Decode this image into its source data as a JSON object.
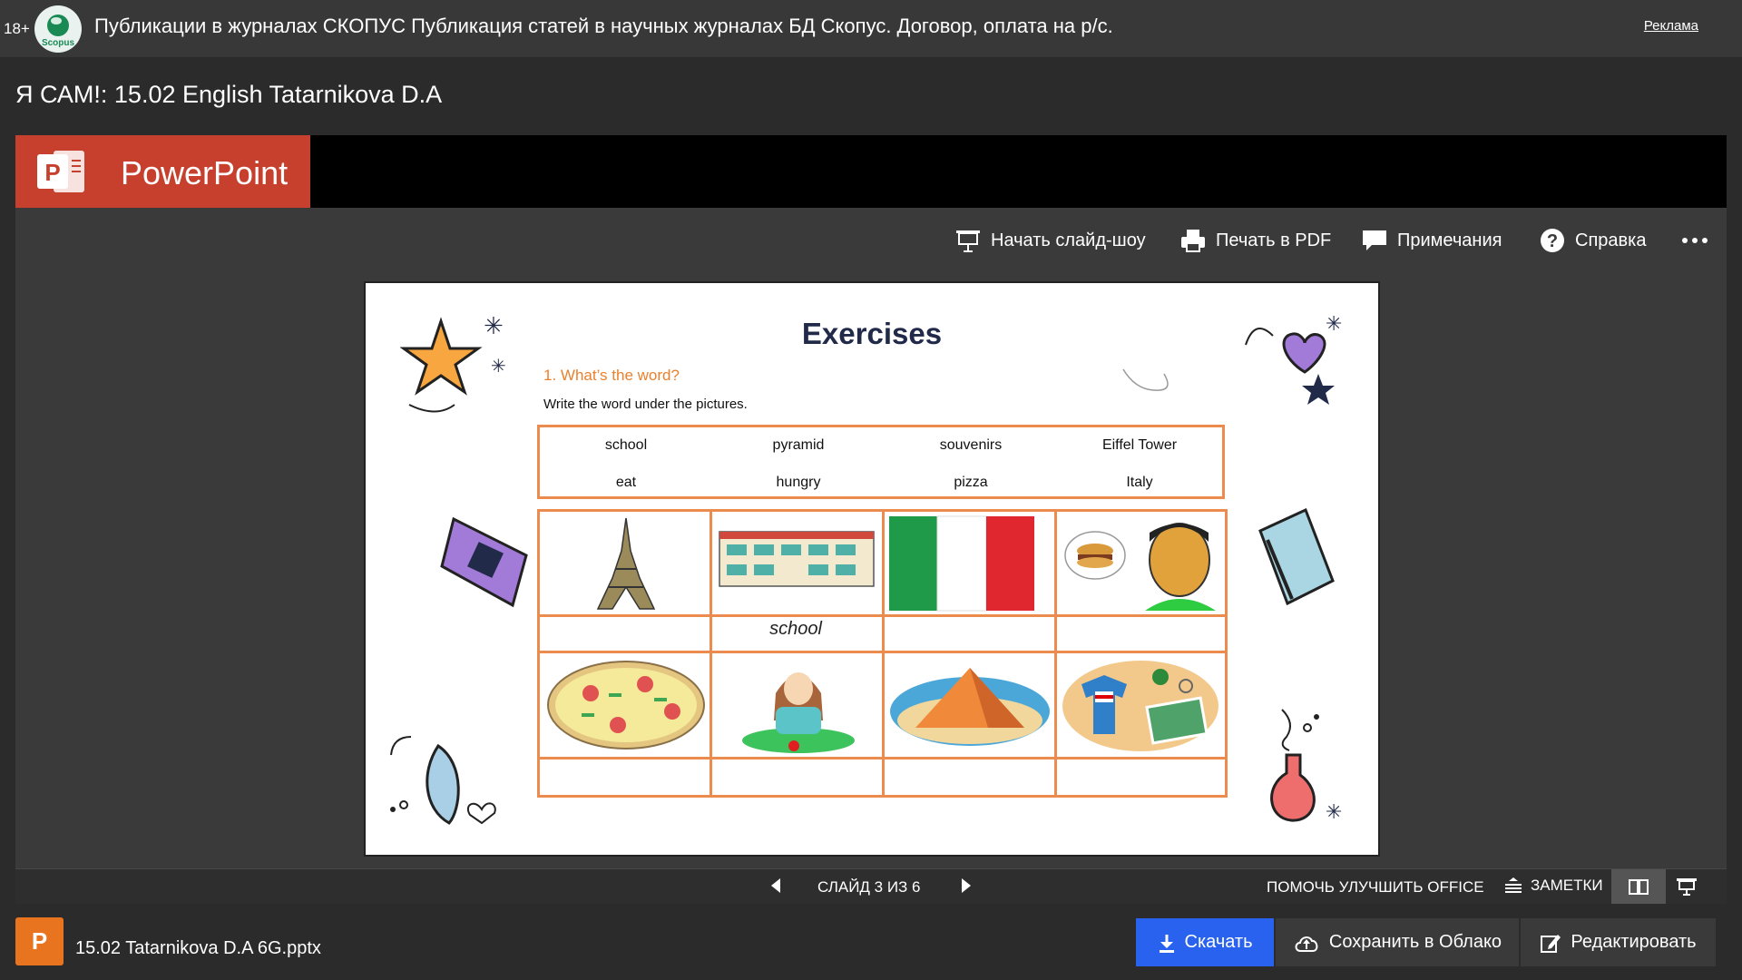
{
  "ad": {
    "age_badge": "18+",
    "logo_text": "Scopus",
    "text": "Публикации в журналах СКОПУС   Публикация статей в научных журналах БД Скопус. Договор, оплата на р/с.",
    "link": "Реклама"
  },
  "document": {
    "title": "Я САМ!: 15.02 English Tatarnikova D.A"
  },
  "viewer": {
    "app_name": "PowerPoint",
    "toolbar": {
      "slideshow": "Начать слайд-шоу",
      "print_pdf": "Печать в PDF",
      "notes": "Примечания",
      "help": "Справка"
    },
    "slide": {
      "title": "Exercises",
      "task": "1. What’s the word?",
      "instruction": "Write the word under the pictures.",
      "words_row1": [
        "school",
        "pyramid",
        "souvenirs",
        "Eiffel Tower"
      ],
      "words_row2": [
        "eat",
        "hungry",
        "pizza",
        "Italy"
      ],
      "answer_filled": "school"
    },
    "status_bar": {
      "slide_counter": "СЛАЙД 3 ИЗ 6",
      "improve": "ПОМОЧЬ УЛУЧШИТЬ OFFICE",
      "notes": "ЗАМЕТКИ"
    }
  },
  "footer": {
    "file_icon_letter": "P",
    "file_name": "15.02 Tatarnikova D.A 6G.pptx",
    "download": "Скачать",
    "save_cloud": "Сохранить в Облако",
    "edit": "Редактировать"
  },
  "colors": {
    "powerpoint_red": "#c7402d",
    "download_blue": "#2a62f0",
    "slide_accent_orange": "#ec8b4e",
    "file_orange": "#e9741f"
  }
}
